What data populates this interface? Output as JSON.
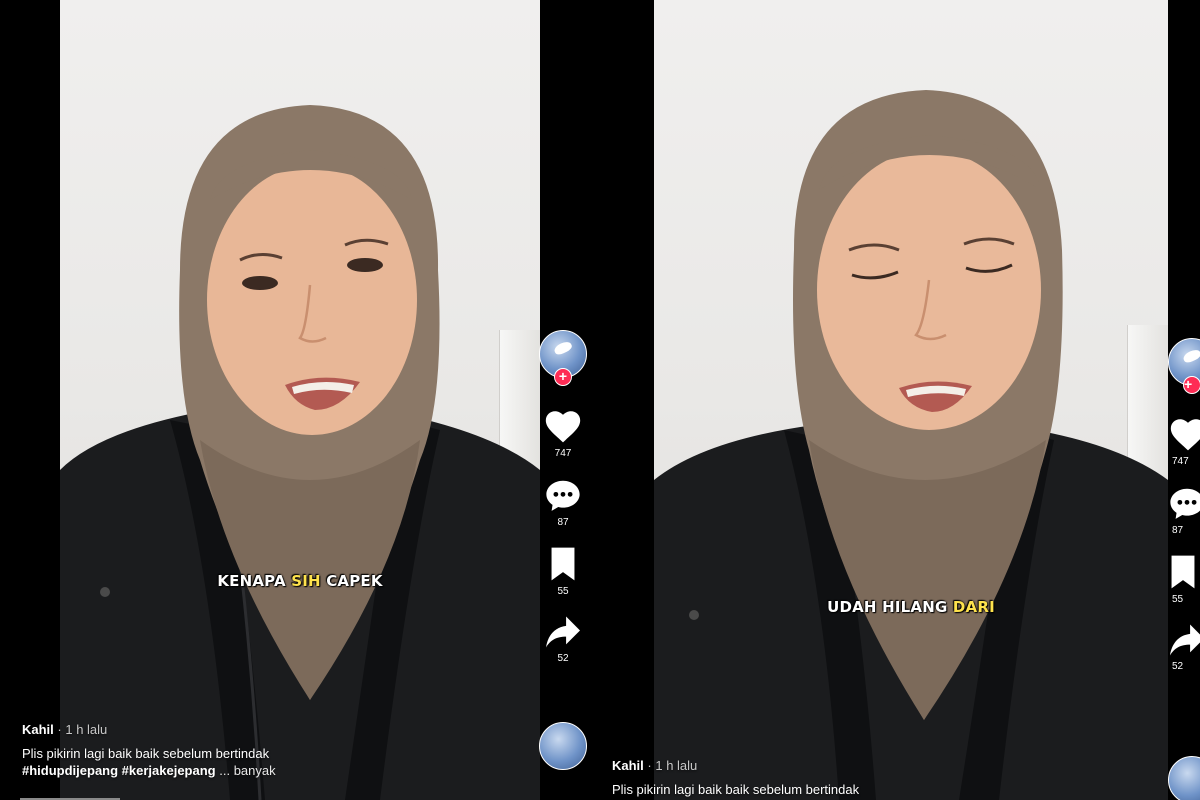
{
  "posts": [
    {
      "caption_parts": [
        "KENAPA ",
        "SIH",
        " CAPEK"
      ],
      "author": "Kahil",
      "time": "· 1 h lalu",
      "description": "Plis pikirin lagi baik baik sebelum bertindak",
      "hashtags": "#hidupdijepang #kerjakejepang",
      "more": "... banyak",
      "actions": {
        "likes": "747",
        "comments": "87",
        "saves": "55",
        "shares": "52"
      }
    },
    {
      "caption_parts": [
        "UDAH HILANG ",
        "DARI"
      ],
      "author": "Kahil",
      "time": "· 1 h lalu",
      "description": "Plis pikirin lagi baik baik sebelum bertindak",
      "actions": {
        "likes": "747",
        "comments": "87",
        "saves": "55",
        "shares": "52"
      }
    }
  ],
  "icons": {
    "follow": "+",
    "like": "heart-icon",
    "comment": "comment-icon",
    "save": "bookmark-icon",
    "share": "share-icon"
  },
  "colors": {
    "follow_badge": "#fe2c55",
    "caption_highlight": "#ffe34d",
    "hijab": "#8b7867",
    "jacket": "#1b1c1e"
  }
}
